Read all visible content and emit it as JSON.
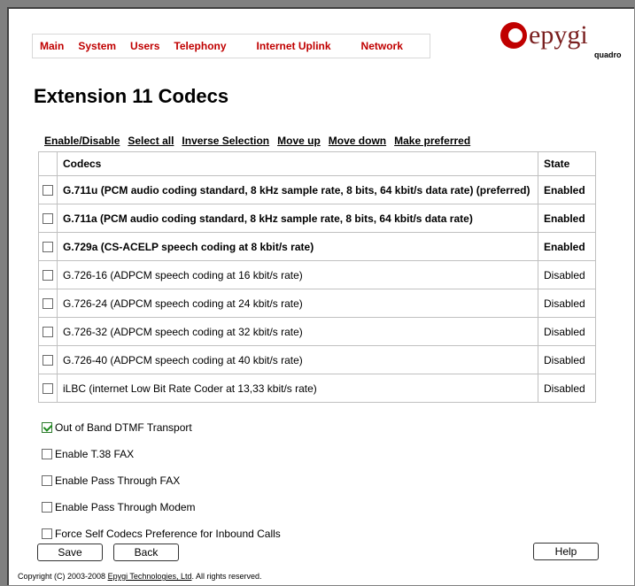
{
  "nav": {
    "items": [
      {
        "label": "Main"
      },
      {
        "label": "System"
      },
      {
        "label": "Users"
      },
      {
        "label": "Telephony"
      },
      {
        "label": "Internet Uplink"
      },
      {
        "label": "Network"
      }
    ]
  },
  "logo": {
    "brand": "epygi",
    "product": "quadro"
  },
  "page": {
    "title": "Extension 11 Codecs"
  },
  "toolbar": {
    "enable_disable": "Enable/Disable",
    "select_all": "Select all",
    "inverse_selection": "Inverse Selection",
    "move_up": "Move up",
    "move_down": "Move down",
    "make_preferred": "Make preferred"
  },
  "table": {
    "headers": {
      "codecs": "Codecs",
      "state": "State"
    },
    "rows": [
      {
        "codec": "G.711u (PCM audio coding standard, 8 kHz sample rate, 8 bits, 64 kbit/s data rate) (preferred)",
        "state": "Enabled",
        "checked": false
      },
      {
        "codec": "G.711a (PCM audio coding standard, 8 kHz sample rate, 8 bits, 64 kbit/s data rate)",
        "state": "Enabled",
        "checked": false
      },
      {
        "codec": "G.729a (CS-ACELP speech coding at 8 kbit/s rate)",
        "state": "Enabled",
        "checked": false
      },
      {
        "codec": "G.726-16 (ADPCM speech coding at 16 kbit/s rate)",
        "state": "Disabled",
        "checked": false
      },
      {
        "codec": "G.726-24 (ADPCM speech coding at 24 kbit/s rate)",
        "state": "Disabled",
        "checked": false
      },
      {
        "codec": "G.726-32 (ADPCM speech coding at 32 kbit/s rate)",
        "state": "Disabled",
        "checked": false
      },
      {
        "codec": "G.726-40 (ADPCM speech coding at 40 kbit/s rate)",
        "state": "Disabled",
        "checked": false
      },
      {
        "codec": "iLBC (internet Low Bit Rate Coder at 13,33 kbit/s rate)",
        "state": "Disabled",
        "checked": false
      }
    ]
  },
  "options": [
    {
      "label": "Out of Band DTMF Transport",
      "checked": true
    },
    {
      "label": "Enable T.38 FAX",
      "checked": false
    },
    {
      "label": "Enable Pass Through FAX",
      "checked": false
    },
    {
      "label": "Enable Pass Through Modem",
      "checked": false
    },
    {
      "label": "Force Self Codecs Preference for Inbound Calls",
      "checked": false
    }
  ],
  "buttons": {
    "save": "Save",
    "back": "Back",
    "help": "Help"
  },
  "footer": {
    "copyright_prefix": "Copyright (C) 2003-2008 ",
    "company_link": "Epygi Technologies, Ltd",
    "copyright_suffix": ". All rights reserved."
  },
  "colors": {
    "nav_text": "#c00000",
    "brand_red": "#c00000",
    "brand_text": "#7a1f1f",
    "enabled_state": "#000000",
    "checkmark": "#1e8a1e"
  }
}
